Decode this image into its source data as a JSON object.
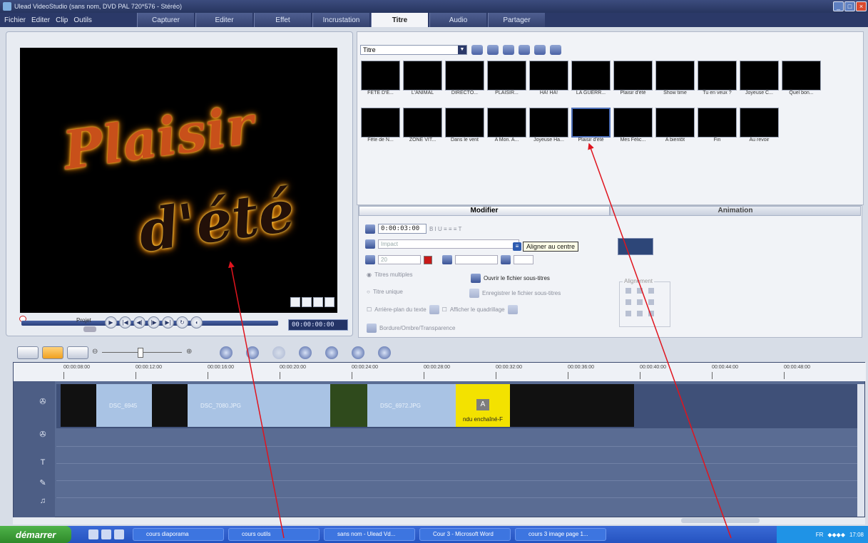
{
  "window": {
    "title": "Ulead VideoStudio (sans nom, DVD PAL 720*576 - Stéréo)"
  },
  "menu": [
    "Fichier",
    "Editer",
    "Clip",
    "Outils"
  ],
  "steps": [
    "Capturer",
    "Editer",
    "Effet",
    "Incrustation",
    "Titre",
    "Audio",
    "Partager"
  ],
  "active_step": "Titre",
  "preview": {
    "line1": "Plaisir",
    "line2": "d'été",
    "projet_label": "Projet",
    "timecode": "00:00:00:00"
  },
  "library": {
    "category": "Titre",
    "thumbnails": [
      "FETE D'E...",
      "L'ANIMAL",
      "DIRECTO...",
      "PLAISIR...",
      "HA! HA!",
      "LA GUERR...",
      "Plaisir d'été",
      "Show time",
      "Tu en veux ?",
      "Joyeuse C...",
      "Quel bon...",
      "Fête de N...",
      "ZONE VIT...",
      "Dans le vent",
      "A Mon. A...",
      "Joyeuse Ha...",
      "Plaisir d'été",
      "Mes Félic...",
      "A bientôt",
      "Fin",
      "Au revoir"
    ],
    "selected_index": 16
  },
  "options": {
    "tab_edit": "Modifier",
    "tab_anim": "Animation",
    "duration": "0:00:03:00",
    "font_name": "Impact",
    "size_value": "20",
    "radio_multiple": "Titres multiples",
    "radio_single": "Titre unique",
    "open_subtitles": "Ouvrir le fichier sous-titres",
    "save_subtitles": "Enregistrer le fichier sous-titres",
    "background": "Arrière-plan du texte",
    "grid": "Afficher le quadrillage",
    "border": "Bordure/Ombre/Transparence",
    "align_label": "Alignement",
    "tooltip": "Aligner au centre"
  },
  "timeline": {
    "ruler": [
      "00:00:08:00",
      "00:00:12:00",
      "00:00:16:00",
      "00:00:20:00",
      "00:00:24:00",
      "00:00:28:00",
      "00:00:32:00",
      "00:00:36:00",
      "00:00:40:00",
      "00:00:44:00",
      "00:00:48:00"
    ],
    "clips": [
      {
        "label": "DSC_6945"
      },
      {
        "label": "DSC_7080.JPG"
      },
      {
        "label": "DSC_6972.JPG"
      },
      {
        "label": "ndu enchaîné-F"
      }
    ]
  },
  "taskbar": {
    "start": "démarrer",
    "tasks": [
      "cours diaporama",
      "cours outils",
      "sans nom - Ulead Vd...",
      "Cour 3 - Microsoft Word",
      "cours 3 image page 1..."
    ],
    "clock": "17:08",
    "lang": "FR"
  },
  "colors": {
    "arrow": "#e0141e",
    "accent": "#2b3968"
  }
}
